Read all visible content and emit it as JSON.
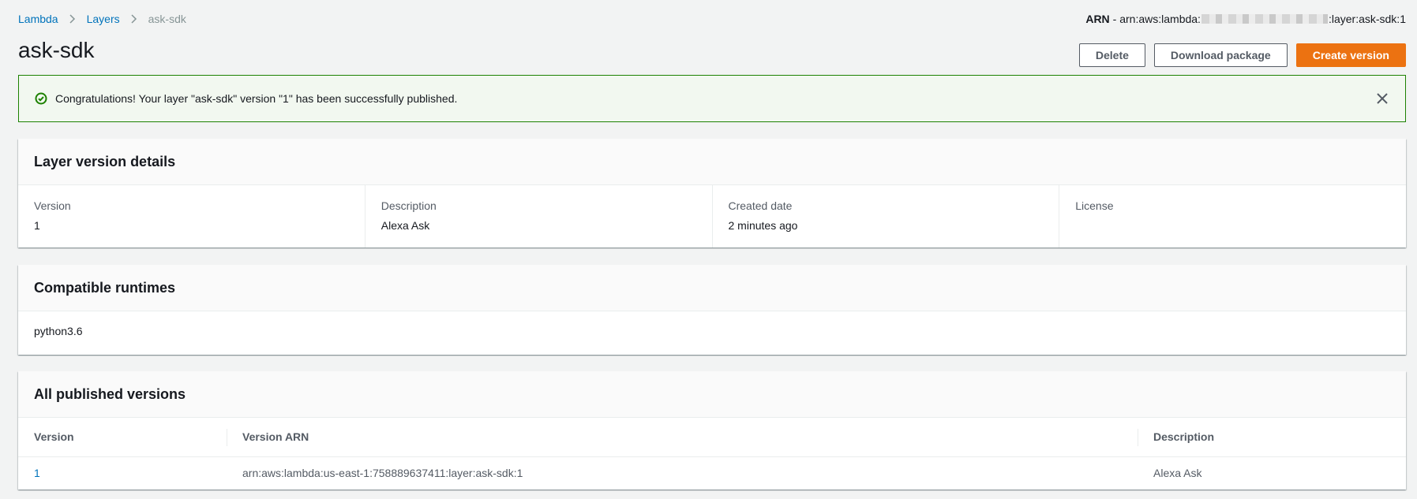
{
  "breadcrumb": {
    "items": [
      "Lambda",
      "Layers"
    ],
    "current": "ask-sdk"
  },
  "arn": {
    "label": "ARN",
    "prefix": "- arn:aws:lambda:",
    "suffix": ":layer:ask-sdk:1"
  },
  "page": {
    "title": "ask-sdk"
  },
  "actions": {
    "delete": "Delete",
    "download": "Download package",
    "create": "Create version"
  },
  "flash": {
    "message": "Congratulations! Your layer \"ask-sdk\" version \"1\" has been successfully published."
  },
  "details": {
    "title": "Layer version details",
    "fields": [
      {
        "label": "Version",
        "value": "1"
      },
      {
        "label": "Description",
        "value": "Alexa Ask"
      },
      {
        "label": "Created date",
        "value": "2 minutes ago"
      },
      {
        "label": "License",
        "value": ""
      }
    ]
  },
  "runtimes": {
    "title": "Compatible runtimes",
    "value": "python3.6"
  },
  "versions": {
    "title": "All published versions",
    "headers": [
      "Version",
      "Version ARN",
      "Description"
    ],
    "rows": [
      {
        "version": "1",
        "arn": "arn:aws:lambda:us-east-1:758889637411:layer:ask-sdk:1",
        "description": "Alexa Ask"
      }
    ]
  },
  "colors": {
    "link": "#0073bb",
    "primary": "#ec7211",
    "success": "#1d8102",
    "background": "#f2f3f3"
  }
}
